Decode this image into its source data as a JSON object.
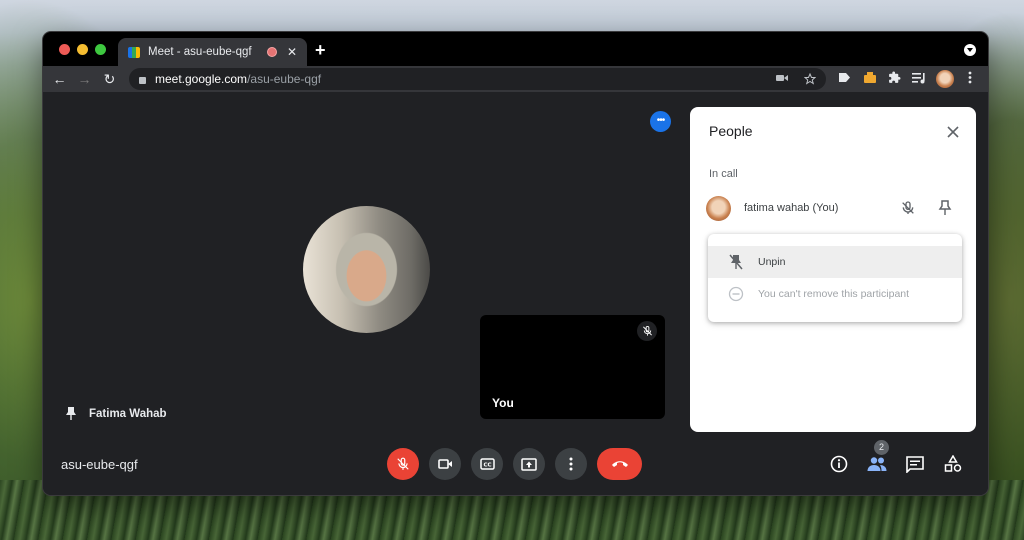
{
  "browser": {
    "tab": {
      "title": "Meet - asu-eube-qgf",
      "recording_indicator": "recording-icon",
      "close_icon": "close-icon"
    },
    "new_tab_label": "+",
    "address": {
      "host": "meet.google.com",
      "path": "/asu-eube-qgf"
    },
    "nav": {
      "back": "←",
      "forward": "→",
      "reload": "↻"
    },
    "toolbar_icons": [
      "camera-icon",
      "star-icon",
      "tag-extension-icon",
      "box-extension-icon",
      "puzzle-extension-icon",
      "playlist-icon",
      "profile-avatar",
      "kebab-menu-icon"
    ]
  },
  "meet": {
    "pinned_participant_name": "Fatima Wahab",
    "self_tile_label": "You",
    "meeting_code": "asu-eube-qgf",
    "participant_count": "2",
    "controls": [
      "mic-off",
      "camera",
      "captions",
      "present",
      "more-options",
      "leave-call"
    ],
    "right_controls": [
      "meeting-info",
      "people",
      "chat",
      "activities"
    ],
    "colors": {
      "accent_blue": "#1a73e8",
      "danger_red": "#ea4335",
      "background": "#202124",
      "control_gray": "#3c4043"
    }
  },
  "people_panel": {
    "title": "People",
    "section_label": "In call",
    "participants": [
      {
        "name": "fatima wahab (You)",
        "muted": true,
        "pinned": true
      }
    ],
    "menu": [
      {
        "label": "Unpin",
        "icon": "unpin-icon",
        "enabled": true
      },
      {
        "label": "You can't remove this participant",
        "icon": "remove-icon",
        "enabled": false
      }
    ]
  }
}
